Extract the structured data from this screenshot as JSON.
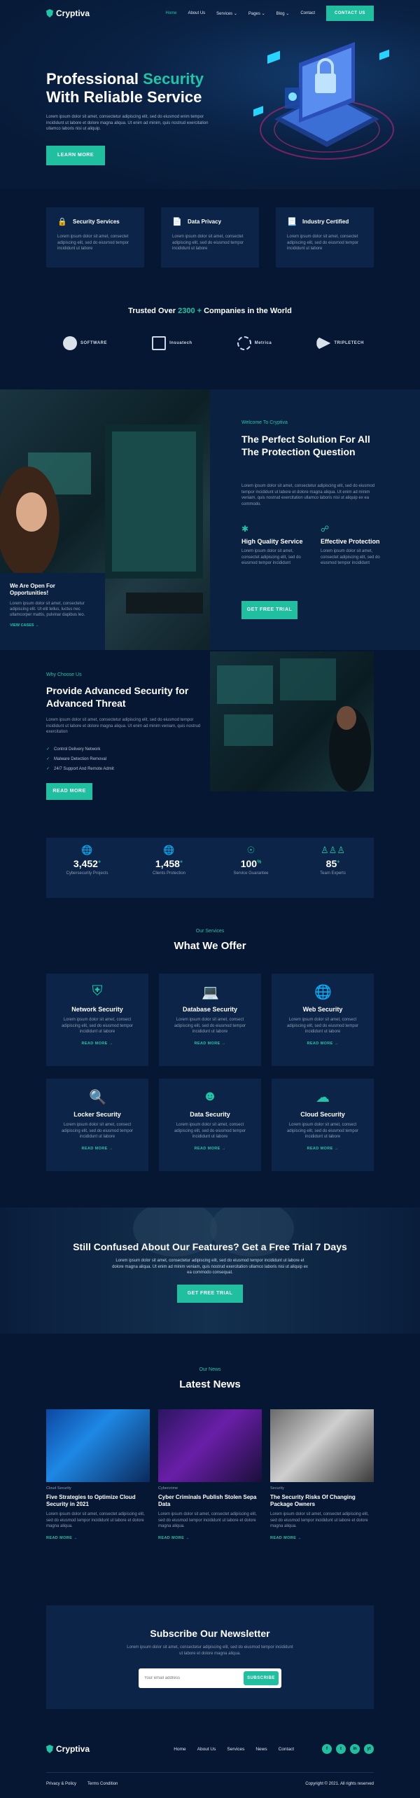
{
  "brand": {
    "name": "Cryptiva"
  },
  "nav": {
    "items": [
      "Home",
      "About Us",
      "Services",
      "Pages",
      "Blog",
      "Contact"
    ],
    "active": "Home",
    "cta": "CONTACT US"
  },
  "hero": {
    "title_a": "Professional ",
    "title_accent": "Security",
    "title_b": "With Reliable Service",
    "text": "Lorem ipsum dolor sit amet, consectetur adipiscing elit, sed do eiusmod enim tempor incididunt ut labore et dolore magna aliqua. Ut enim ad minim, quis nostrud exercitation ullamco laboris nisi ut aliquip.",
    "button": "LEARN MORE"
  },
  "features": [
    {
      "title": "Security Services",
      "icon": "lock-icon",
      "text": "Lorem ipsum dolor sit amet, consectet adipiscing elit, sed do eiusmod tempor incididunt ut labore"
    },
    {
      "title": "Data Privacy",
      "icon": "document-icon",
      "text": "Lorem ipsum dolor sit amet, consectet adipiscing elit, sed do eiusmod tempor incididunt ut labore"
    },
    {
      "title": "Industry Certified",
      "icon": "certificate-icon",
      "text": "Lorem ipsum dolor sit amet, consectet adipiscing elit, sed do eiusmod tempor incididunt ut labore"
    }
  ],
  "trusted": {
    "before": "Trusted Over ",
    "number": "2300 +",
    "after": " Companies in the World"
  },
  "partners": [
    "SOFTWARE",
    "Insuatech",
    "Metrica",
    "TRIPLETECH"
  ],
  "about": {
    "open_title": "We Are Open For Opportunities!",
    "open_text": "Lorem ipsum dolor sit amet, consectetur adipiscing elit. Ut elit tellus, luctus nec ullamcorper mattis, pulvinar dapibus leo.",
    "open_link": "VIEW CASES →",
    "tag": "Welcome To Cryptiva",
    "title": "The Perfect Solution For All The Protection Question",
    "text": "Lorem ipsum dolor sit amet, consectetur adipiscing elit, sed do eiusmod tempor incididunt ut labore et dolore magna aliqua. Ut enim ad minim veniam, quis nostrud exercitation ullamco laboris nisi ut aliquip ex ea commodo.",
    "f1_title": "High Quality Service",
    "f1_text": "Lorem ipsum dolor sit amet, consectet adipiscing elit, sed do eiusmod tempor incididunt",
    "f2_title": "Effective Protection",
    "f2_text": "Lorem ipsum dolor sit amet, consectet adipiscing elit, sed do eiusmod tempor incididunt",
    "button": "GET FREE TRIAL"
  },
  "why": {
    "tag": "Why Choose Us",
    "title": "Provide Advanced Security for Advanced Threat",
    "text": "Lorem ipsum dolor sit amet, consectetur adipiscing elit, sed do eiusmod tempor incididunt ut labore et dolore magna aliqua. Ut enim ad minim veniam, quis nostrud exercitation",
    "list": [
      "Control Delivery Network",
      "Malware Detection Removal",
      "24/7 Support And Remote Admit"
    ],
    "button": "READ MORE"
  },
  "stats": [
    {
      "number": "3,452",
      "suffix": "+",
      "label": "Cybersecurity Projects"
    },
    {
      "number": "1,458",
      "suffix": "+",
      "label": "Clients Protection"
    },
    {
      "number": "100",
      "suffix": "%",
      "label": "Service Guarantee"
    },
    {
      "number": "85",
      "suffix": "+",
      "label": "Team Experts"
    }
  ],
  "services": {
    "tag": "Our Services",
    "title": "What We Offer",
    "items": [
      {
        "title": "Network Security",
        "text": "Lorem ipsum dolor sit amet, consect adipiscing elit, sed do eiusmod tempor incididunt ut labore",
        "more": "READ MORE →"
      },
      {
        "title": "Database Security",
        "text": "Lorem ipsum dolor sit amet, consect adipiscing elit, sed do eiusmod tempor incididunt ut labore",
        "more": "READ MORE →"
      },
      {
        "title": "Web Security",
        "text": "Lorem ipsum dolor sit amet, consect adipiscing elit, sed do eiusmod tempor incididunt ut labore",
        "more": "READ MORE →"
      },
      {
        "title": "Locker Security",
        "text": "Lorem ipsum dolor sit amet, consect adipiscing elit, sed do eiusmod tempor incididunt ut labore",
        "more": "READ MORE →"
      },
      {
        "title": "Data Security",
        "text": "Lorem ipsum dolor sit amet, consect adipiscing elit, sed do eiusmod tempor incididunt ut labore",
        "more": "READ MORE →"
      },
      {
        "title": "Cloud Security",
        "text": "Lorem ipsum dolor sit amet, consect adipiscing elit, sed do eiusmod tempor incididunt ut labore",
        "more": "READ MORE →"
      }
    ]
  },
  "trial": {
    "title": "Still Confused About Our Features? Get a Free Trial 7 Days",
    "text": "Lorem ipsum dolor sit amet, consectetur adipiscing elit, sed do eiusmod tempor incididunt ut labore et dolore magna aliqua. Ut enim ad minim veniam, quis nostrud exercitation ullamco laboris nisi ut aliquip ex ea commodo consequat.",
    "button": "GET FREE TRIAL"
  },
  "news": {
    "tag": "Our News",
    "title": "Latest News",
    "items": [
      {
        "category": "Cloud Security",
        "title": "Five Strategies to Optimize Cloud Security in 2021",
        "text": "Lorem ipsum dolor sit amet, consectet adipiscing elit, sed do eiusmod tempor incididunt ut labore et dolore magna aliqua.",
        "more": "READ MORE →"
      },
      {
        "category": "Cybercrime",
        "title": "Cyber Criminals Publish Stolen Sepa Data",
        "text": "Lorem ipsum dolor sit amet, consectet adipiscing elit, sed do eiusmod tempor incididunt ut labore et dolore magna aliqua.",
        "more": "READ MORE →"
      },
      {
        "category": "Security",
        "title": "The Security Risks Of Changing Package Owners",
        "text": "Lorem ipsum dolor sit amet, consectet adipiscing elit, sed do eiusmod tempor incididunt ut labore et dolore magna aliqua.",
        "more": "READ MORE →"
      }
    ]
  },
  "newsletter": {
    "title": "Subscribe Our Newsletter",
    "text": "Lorem ipsum dolor sit amet, consectetur adipiscing elit, sed do eiusmod tempor incididunt ut labore et dolore magna aliqua.",
    "placeholder": "Your email address",
    "button": "SUBSCRIBE"
  },
  "footer": {
    "menu": [
      "Home",
      "About Us",
      "Services",
      "News",
      "Contact"
    ],
    "social": [
      "f",
      "t",
      "in",
      "yt"
    ],
    "privacy": "Privacy & Policy",
    "terms": "Terms Condition",
    "copyright": "Copyright © 2021. All rights reserved"
  },
  "colors": {
    "accent": "#1fbf9f",
    "background": "#061733",
    "card": "#0b2447"
  }
}
